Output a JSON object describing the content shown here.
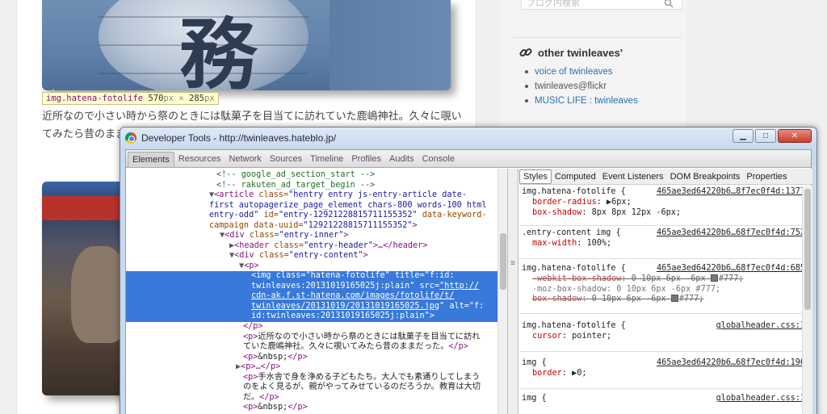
{
  "blog": {
    "tooltip": {
      "selector": "img.hatena-fotolife",
      "width": "570",
      "px1": "px",
      "times": " × ",
      "height": "285",
      "px2": "px"
    },
    "paragraph": "近所なので小さい時から祭のときには駄菓子を目当てに訪れていた鹿嶋神社。久々に覗いてみたら昔のままだった。"
  },
  "sidebar": {
    "search_placeholder": "ブログ内検索",
    "title": "other twinleaves'",
    "items": [
      {
        "label": "voice of twinleaves",
        "link": true
      },
      {
        "label": "twinleaves@flickr",
        "link": false
      },
      {
        "label": "MUSIC LIFE : twinleaves",
        "link": true
      }
    ]
  },
  "devtools": {
    "window_title": "Developer Tools - http://twinleaves.hateblo.jp/",
    "window_buttons": {
      "minimize": "▁",
      "maximize": "□",
      "close": "✕"
    },
    "tabs": [
      "Elements",
      "Resources",
      "Network",
      "Sources",
      "Timeline",
      "Profiles",
      "Audits",
      "Console"
    ],
    "side_tabs": [
      "Styles",
      "Computed",
      "Event Listeners",
      "DOM Breakpoints",
      "Properties"
    ],
    "dom": {
      "l1": "<!-- google_ad_section_start -->",
      "l2": "<!-- rakuten_ad_target_begin -->",
      "l3_tag": "<article ",
      "l3_a1": "class=",
      "l3_v1": "\"hentry entry js-entry-article date-",
      "l4": "first autopagerize_page_element chars-800 words-100 html",
      "l5a": "entry-odd\"",
      "l5b": " id=",
      "l5c": "\"entry-12921228815711155352\"",
      "l5d": " data-keyword-",
      "l6a": "campaign",
      "l6b": " data-uuid=",
      "l6c": "\"12921228815711155352\"",
      "l6d": ">",
      "l7a": "<div ",
      "l7b": "class=",
      "l7c": "\"entry-inner\"",
      "l7d": ">",
      "l8a": "<header ",
      "l8b": "class=",
      "l8c": "\"entry-header\"",
      "l8d": ">…</header>",
      "l9a": "<div ",
      "l9b": "class=",
      "l9c": "\"entry-content\"",
      "l9d": ">",
      "l10": "<p>",
      "s1a": "<img ",
      "s1b": "class=",
      "s1c": "\"hatena-fotolife\"",
      "s1d": " title=",
      "s1e": "\"f:id:",
      "s2a": "twinleaves:20131019165025j:plain\"",
      "s2b": " src=",
      "s2c": "\"http://",
      "s3": "cdn-ak.f.st-hatena.com/images/fotolife/t/",
      "s4a": "twinleaves/20131019/20131019165025.jpg",
      "s4b": "\"",
      "s4c": " alt=",
      "s4d": "\"f:",
      "s5": "id:twinleaves:20131019165025j:plain\">",
      "l11": "</p>",
      "l12a": "<p>",
      "l12b": "近所なので小さい時から祭のときには駄菓子を目当てに訪れ",
      "l13a": "ていた鹿嶋神社。久々に覗いてみたら昔のままだった。",
      "l13b": "</p>",
      "l14a": "<p>",
      "l14b": "&nbsp;",
      "l14c": "</p>",
      "l15": "<p>…</p>",
      "l16a": "<p>",
      "l16b": "手水舎で身を浄める子どもたち。大人でも素通りしてしまう",
      "l17": "のをよく見るが、親がやってみせているのだろうか。教育は大切",
      "l18a": "だ。",
      "l18b": "</p>",
      "l19a": "<p>",
      "l19b": "&nbsp;",
      "l19c": "</p>"
    },
    "styles": [
      {
        "selector": "img.hatena-fotolife {",
        "source": "465ae3ed64220b6…8f7ec0f4d:1377",
        "decls": [
          {
            "prop": "border-radius",
            "value": "▶6px;",
            "strike": false
          },
          {
            "prop": "box-shadow",
            "value": "8px 8px 12px -6px;",
            "strike": false
          }
        ]
      },
      {
        "selector": ".entry-content img {",
        "source": "465ae3ed64220b6…68f7ec0f4d:752",
        "decls": [
          {
            "prop": "max-width",
            "value": "100%;",
            "strike": false
          }
        ]
      },
      {
        "selector": "img.hatena-fotolife {",
        "source": "465ae3ed64220b6…68f7ec0f4d:685",
        "decls": [
          {
            "prop": "-webkit-box-shadow",
            "value": "0 10px 6px -6px ",
            "tail": "#777;",
            "swatch": true,
            "strike": true
          },
          {
            "prop": "-moz-box-shadow",
            "value": "0 10px 6px -6px #777;",
            "strike": true,
            "muted": true
          },
          {
            "prop": "box-shadow",
            "value": "0 10px 6px -6px ",
            "tail": "#777;",
            "swatch": true,
            "strike": true
          }
        ]
      },
      {
        "selector": "img.hatena-fotolife {",
        "source": "globalheader.css:1",
        "decls": [
          {
            "prop": "cursor",
            "value": "pointer;",
            "strike": false
          }
        ]
      },
      {
        "selector": "img {",
        "source": "465ae3ed64220b6…68f7ec0f4d:196",
        "decls": [
          {
            "prop": "border",
            "value": "▶0;",
            "strike": false
          }
        ]
      },
      {
        "selector": "img {",
        "source": "globalheader.css:1",
        "decls": []
      }
    ]
  }
}
